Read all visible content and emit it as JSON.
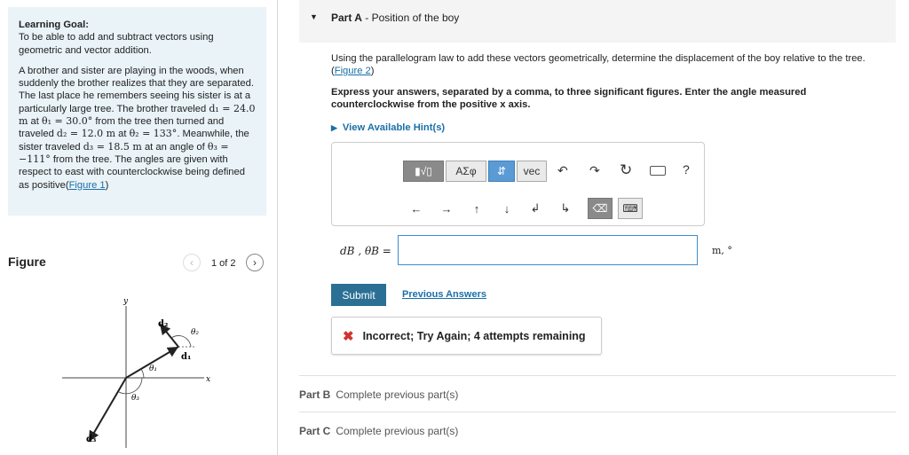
{
  "goal": {
    "title": "Learning Goal:",
    "text": "To be able to add and subtract vectors using geometric and vector addition.",
    "problem_parts": [
      "A brother and sister are playing in the woods, when suddenly the brother realizes that they are separated. The last place he remembers seeing his sister is at a particularly large tree. The brother traveled ",
      "d₁ = 24.0 m",
      " at ",
      "θ₁ = 30.0°",
      " from the tree then turned and traveled ",
      "d₂ = 12.0 m",
      " at ",
      "θ₂ = 133°",
      ". Meanwhile, the sister traveled ",
      "d₃ = 18.5 m",
      " at an angle of ",
      "θ₃ = −111°",
      " from the tree. The angles are given with respect to east with counterclockwise being defined as positive("
    ],
    "figure_link": "Figure 1",
    "tail": ")"
  },
  "figure": {
    "title": "Figure",
    "counter": "1 of 2",
    "prev_icon": "chevron-left-icon",
    "next_icon": "chevron-right-icon",
    "labels": {
      "y": "y",
      "x": "x",
      "d1": "d₁",
      "d2": "d₂",
      "d3": "d₃",
      "t1": "θ₁",
      "t2": "θ₂",
      "t3": "θ₃"
    }
  },
  "partA": {
    "key": "Part A",
    "title": " - Position of the boy",
    "instruction": "Using the parallelogram law to add these vectors geometrically, determine the displacement of the boy relative to the tree.",
    "figure_link": "Figure 2",
    "format_note": "Express your answers, separated by a comma, to three significant figures. Enter the angle measured counterclockwise from the positive x axis.",
    "hint_label": "View Available Hint(s)",
    "answer_label": "dB , θB =",
    "answer_value": "",
    "units": "m, °",
    "submit": "Submit",
    "previous_answers": "Previous Answers",
    "feedback": "Incorrect; Try Again; 4 attempts remaining"
  },
  "toolbar": {
    "templates": "templates-icon",
    "greek": "ΑΣφ",
    "arrows": "⇵",
    "vec": "vec",
    "undo": "↶",
    "redo": "↷",
    "reset": "↻",
    "keyboard": "keyboard-icon",
    "help": "?",
    "row2": [
      "←",
      "→",
      "↑",
      "↓",
      "↲",
      "↳"
    ]
  },
  "partB": {
    "key": "Part B",
    "text": "Complete previous part(s)"
  },
  "partC": {
    "key": "Part C",
    "text": "Complete previous part(s)"
  },
  "colors": {
    "accent": "#2b6f94",
    "link": "#1a6fa8",
    "error": "#d0342c",
    "goal_bg": "#e9f3f8"
  }
}
